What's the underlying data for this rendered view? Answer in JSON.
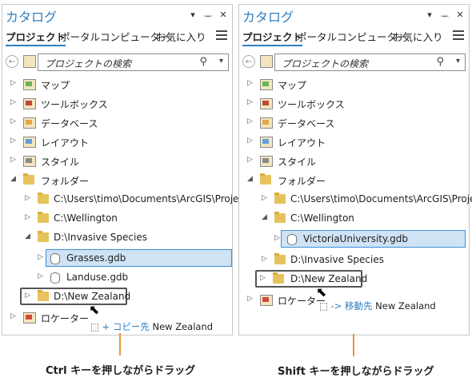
{
  "panels": [
    {
      "title": "カタログ",
      "tabs": [
        "プロジェクト",
        "ポータル",
        "コンピューター",
        "お気に入り"
      ],
      "search_placeholder": "プロジェクトの検索",
      "items": {
        "map": "マップ",
        "toolbox": "ツールボックス",
        "database": "データベース",
        "layout": "レイアウト",
        "style": "スタイル",
        "folder": "フォルダー",
        "folder_arcgis": "C:\\Users\\timo\\Documents\\ArcGIS\\Projec",
        "folder_wellington": "C:\\Wellington",
        "folder_invasive": "D:\\Invasive Species",
        "grasses": "Grasses.gdb",
        "landuse": "Landuse.gdb",
        "folder_nz": "D:\\New Zealand",
        "locator": "ロケーター"
      },
      "drop_hint": {
        "op": "+ コピー先",
        "target": "New Zealand"
      },
      "caption": "Ctrl キーを押しながらドラッグ"
    },
    {
      "title": "カタログ",
      "tabs": [
        "プロジェクト",
        "ポータル",
        "コンピューター",
        "お気に入り"
      ],
      "search_placeholder": "プロジェクトの検索",
      "items": {
        "map": "マップ",
        "toolbox": "ツールボックス",
        "database": "データベース",
        "layout": "レイアウト",
        "style": "スタイル",
        "folder": "フォルダー",
        "folder_arcgis": "C:\\Users\\timo\\Documents\\ArcGIS\\Projec",
        "folder_wellington": "C:\\Wellington",
        "victoria": "VictoriaUniversity.gdb",
        "folder_invasive": "D:\\Invasive Species",
        "folder_nz": "D:\\New Zealand",
        "locator": "ロケーター"
      },
      "drop_hint": {
        "op": "-> 移動先",
        "target": "New Zealand"
      },
      "caption": "Shift キーを押しながらドラッグ"
    }
  ]
}
